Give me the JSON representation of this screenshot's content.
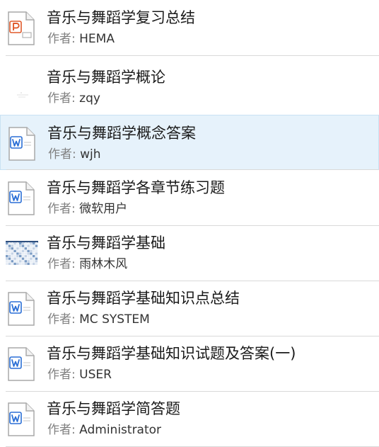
{
  "author_prefix": "作者:",
  "documents": [
    {
      "title": "音乐与舞蹈学复习总结",
      "author": "HEMA",
      "icon": "ppt-file-icon",
      "selected": false
    },
    {
      "title": "音乐与舞蹈学概论",
      "author": "zqy",
      "icon": "faint-thumbnail-icon",
      "selected": false
    },
    {
      "title": "音乐与舞蹈学概念答案",
      "author": "wjh",
      "icon": "word-file-icon",
      "selected": true
    },
    {
      "title": "音乐与舞蹈学各章节练习题",
      "author": "微软用户",
      "icon": "word-file-icon",
      "selected": false
    },
    {
      "title": "音乐与舞蹈学基础",
      "author": "雨林木风",
      "icon": "spreadsheet-thumbnail-icon",
      "selected": false
    },
    {
      "title": "音乐与舞蹈学基础知识点总结",
      "author": "MC SYSTEM",
      "icon": "word-file-icon",
      "selected": false
    },
    {
      "title": "音乐与舞蹈学基础知识试题及答案(一)",
      "author": "USER",
      "icon": "word-file-icon",
      "selected": false
    },
    {
      "title": "音乐与舞蹈学简答题",
      "author": "Administrator",
      "icon": "word-file-icon",
      "selected": false
    }
  ],
  "colors": {
    "ppt_accent": "#e05a2b",
    "word_accent": "#2b6fd6",
    "selected_bg": "#e6f2fb"
  }
}
